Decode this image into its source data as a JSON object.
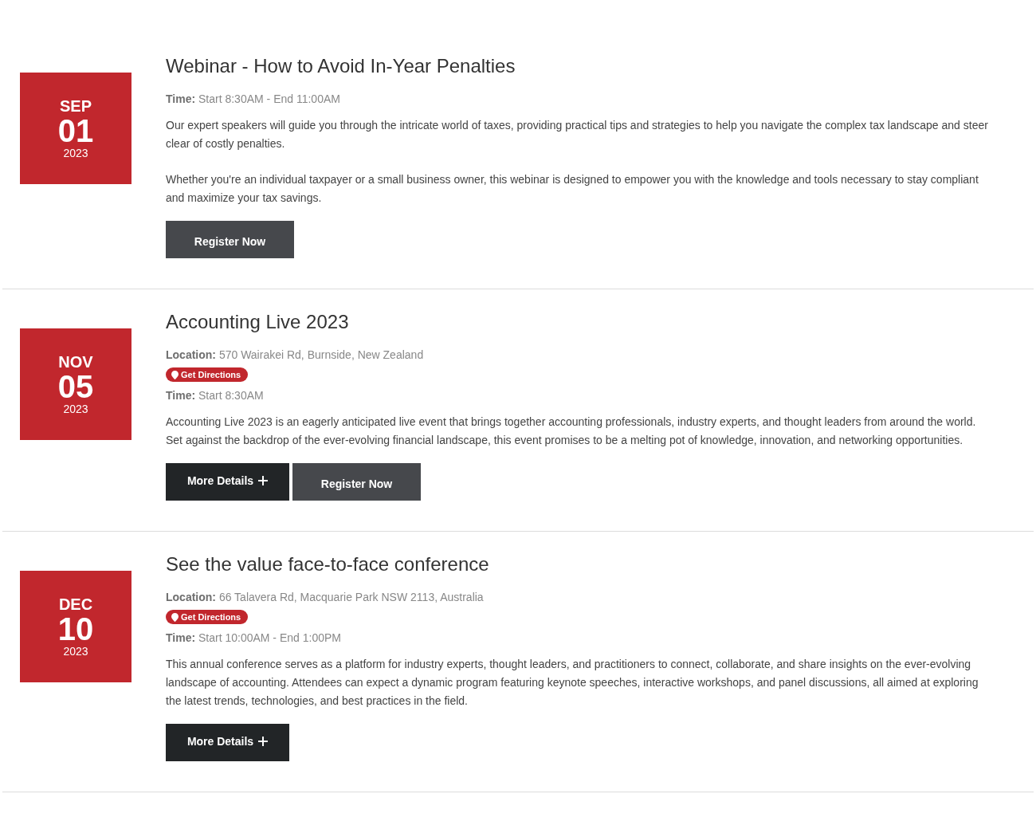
{
  "events": [
    {
      "date": {
        "month": "SEP",
        "day": "01",
        "year": "2023"
      },
      "title": "Webinar - How to Avoid In-Year Penalties",
      "time": {
        "label": "Time:",
        "value": "Start 8:30AM - End 11:00AM"
      },
      "description": [
        "Our expert speakers will guide you through the intricate world of taxes, providing practical tips and strategies to help you navigate the complex tax landscape and steer clear of costly penalties.",
        "Whether you're an individual taxpayer or a small business owner, this webinar is designed to empower you with the knowledge and tools necessary to stay compliant and maximize your tax savings."
      ],
      "buttons": [
        {
          "kind": "register",
          "label": "Register Now"
        }
      ]
    },
    {
      "date": {
        "month": "NOV",
        "day": "05",
        "year": "2023"
      },
      "title": "Accounting Live 2023",
      "location": {
        "label": "Location:",
        "value": "570 Wairakei Rd, Burnside, New Zealand"
      },
      "directions": "Get Directions",
      "time": {
        "label": "Time:",
        "value": "Start 8:30AM"
      },
      "description": [
        "Accounting Live 2023 is an eagerly anticipated live event that brings together accounting professionals, industry experts, and thought leaders from around the world. Set against the backdrop of the ever-evolving financial landscape, this event promises to be a melting pot of knowledge, innovation, and networking opportunities."
      ],
      "buttons": [
        {
          "kind": "details",
          "label": "More Details"
        },
        {
          "kind": "register",
          "label": "Register Now"
        }
      ]
    },
    {
      "date": {
        "month": "DEC",
        "day": "10",
        "year": "2023"
      },
      "title": "See the value face-to-face conference",
      "location": {
        "label": "Location:",
        "value": "66 Talavera Rd, Macquarie Park NSW 2113, Australia"
      },
      "directions": "Get Directions",
      "time": {
        "label": "Time:",
        "value": "Start 10:00AM - End 1:00PM"
      },
      "description": [
        "This annual conference serves as a platform for industry experts, thought leaders, and practitioners to connect, collaborate, and share insights on the ever-evolving landscape of accounting. Attendees can expect a dynamic program featuring keynote speeches, interactive workshops, and panel discussions, all aimed at exploring the latest trends, technologies, and best practices in the field."
      ],
      "buttons": [
        {
          "kind": "details",
          "label": "More Details"
        }
      ]
    }
  ]
}
